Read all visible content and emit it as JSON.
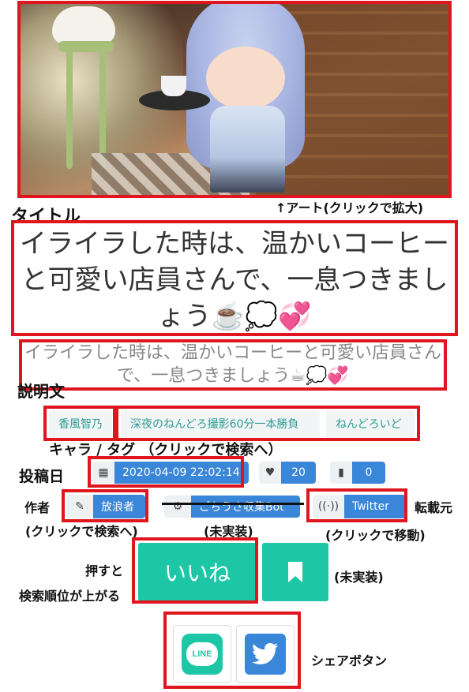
{
  "art": {
    "annotation": "↑アート(クリックで拡大)"
  },
  "annotations": {
    "title": "タイトル",
    "description": "説明文",
    "tags": "キャラ / タグ （クリックで検索へ）",
    "post_date": "投稿日",
    "author": "作者",
    "author_sub": "(クリックで検索へ)",
    "unimplemented": "(未実装)",
    "source": "転載元",
    "source_sub": "(クリックで移動)",
    "like_line1": "押すと",
    "like_line2": "検索順位が上がる",
    "bookmark_unimplemented": "(未実装)",
    "share": "シェアボタン"
  },
  "post": {
    "title": "イライラした時は、温かいコーヒーと可愛い店員さんで、一息つきましょう☕💭💞",
    "description": "イライラした時は、温かいコーヒーと可愛い店員さんで、一息つきましょう☕💭💞"
  },
  "tags": [
    "香風智乃",
    "深夜のねんどろ撮影60分一本勝負",
    "ねんどろいど"
  ],
  "meta": {
    "date": "2020-04-09 22:02:14",
    "likes": "20",
    "bookmarks": "0",
    "author": "放浪者",
    "collector": "ごちうさ収集Bot",
    "source": "Twitter"
  },
  "buttons": {
    "like": "いいね"
  },
  "share": {
    "line_label": "LINE"
  },
  "colors": {
    "accent_teal": "#1dc7a6",
    "blue": "#3a86d8",
    "annotation_red": "#e0161e"
  },
  "icons": [
    "calendar-icon",
    "heart-icon",
    "bookmark-icon",
    "brush-icon",
    "robot-icon",
    "broadcast-icon",
    "line-icon",
    "twitter-icon"
  ]
}
